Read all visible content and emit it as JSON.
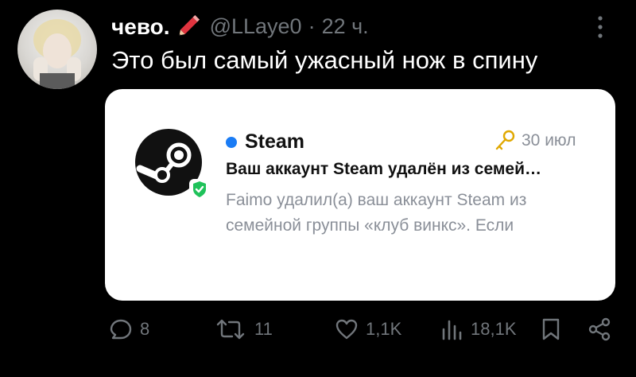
{
  "tweet": {
    "author_name": "чево.",
    "handle": "@LLaye0",
    "separator": "·",
    "time": "22 ч.",
    "text": "Это был самый ужасный нож в спину"
  },
  "card": {
    "source": "Steam",
    "date": "30 июл",
    "title": "Ваш аккаунт Steam удалён из семей…",
    "body": "Faimo удалил(а) ваш аккаунт Steam из семейной группы «клуб винкс». Если",
    "accent_color": "#1a7cf5",
    "badge_color": "#1fc25a"
  },
  "actions": {
    "replies": "8",
    "retweets": "11",
    "likes": "1,1K",
    "views": "18,1K"
  },
  "icons": [
    "pencil-emoji-icon",
    "more-icon",
    "steam-logo-icon",
    "verified-shield-icon",
    "key-icon",
    "reply-icon",
    "retweet-icon",
    "like-icon",
    "views-icon",
    "bookmark-icon",
    "share-icon"
  ]
}
